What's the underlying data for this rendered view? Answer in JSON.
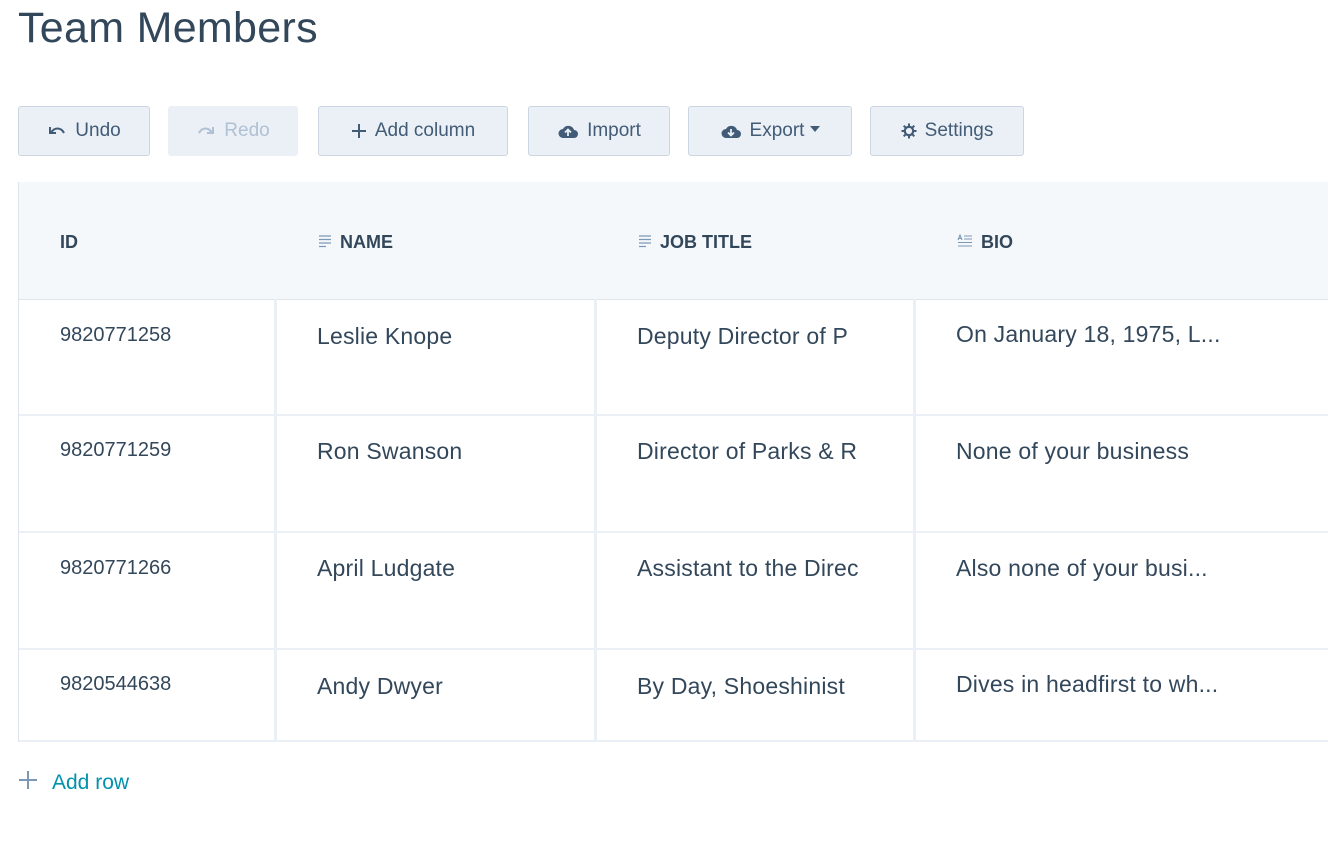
{
  "page": {
    "title": "Team Members"
  },
  "toolbar": {
    "undo": {
      "label": "Undo",
      "icon": "undo-icon"
    },
    "redo": {
      "label": "Redo",
      "icon": "redo-icon"
    },
    "add_column": {
      "label": "Add column",
      "icon": "plus-icon"
    },
    "import": {
      "label": "Import",
      "icon": "cloud-upload-icon"
    },
    "export": {
      "label": "Export",
      "icon": "cloud-download-icon"
    },
    "settings": {
      "label": "Settings",
      "icon": "gear-icon"
    }
  },
  "table": {
    "columns": [
      {
        "label": "ID",
        "icon": ""
      },
      {
        "label": "NAME",
        "icon": "text-icon"
      },
      {
        "label": "JOB TITLE",
        "icon": "text-icon"
      },
      {
        "label": "BIO",
        "icon": "rich-text-icon"
      }
    ],
    "rows": [
      {
        "id": "9820771258",
        "name": "Leslie Knope",
        "job_title": "Deputy Director of P",
        "bio": "On January 18, 1975, L..."
      },
      {
        "id": "9820771259",
        "name": "Ron Swanson",
        "job_title": "Director of Parks & R",
        "bio": "None of your business"
      },
      {
        "id": "9820771266",
        "name": "April Ludgate",
        "job_title": "Assistant to the Direc",
        "bio": "Also none of your busi..."
      },
      {
        "id": "9820544638",
        "name": "Andy Dwyer",
        "job_title": "By Day, Shoeshinist",
        "bio": "Dives in headfirst to wh..."
      }
    ]
  },
  "footer": {
    "add_row_label": "Add row"
  },
  "colors": {
    "text": "#33475b",
    "button_bg": "#eaf0f6",
    "border": "#cbd6e2",
    "link": "#0091ae",
    "header_bg": "#f5f8fa"
  }
}
